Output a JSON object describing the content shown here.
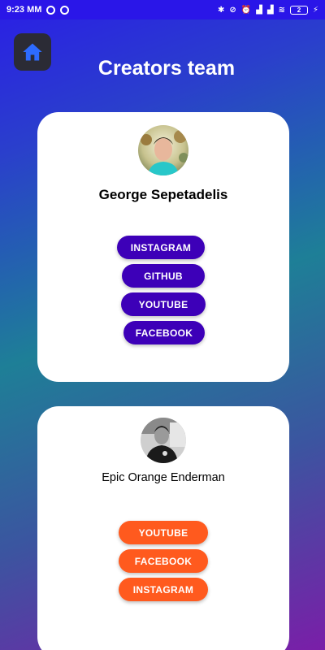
{
  "status_bar": {
    "time": "9:23 MM",
    "battery": "2"
  },
  "header": {
    "title": "Creators team",
    "home_icon": "home-icon"
  },
  "creators": [
    {
      "name": "George Sepetadelis",
      "accent": "#3d00b8",
      "buttons": [
        "INSTAGRAM",
        "GITHUB",
        "YOUTUBE",
        "FACEBOOK"
      ]
    },
    {
      "name": "Epic Orange Enderman",
      "accent": "#ff5a1e",
      "buttons": [
        "YOUTUBE",
        "FACEBOOK",
        "INSTAGRAM"
      ]
    }
  ]
}
